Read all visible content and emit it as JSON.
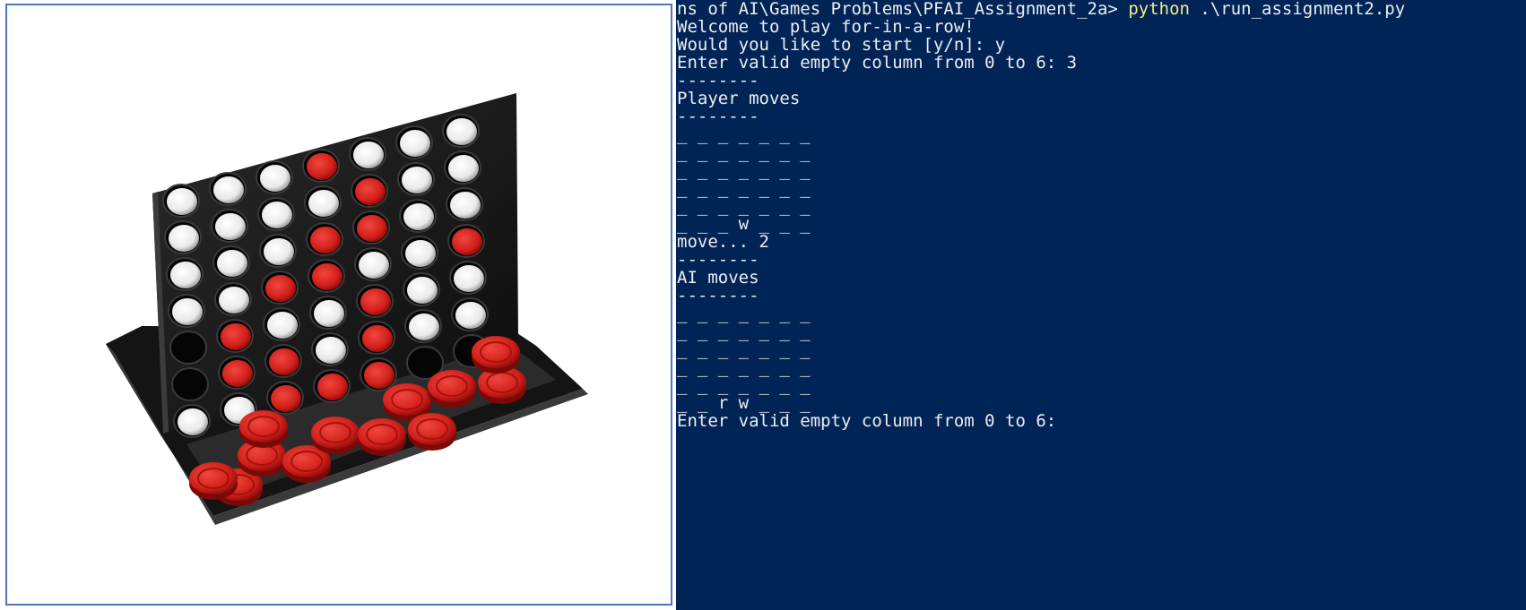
{
  "colors": {
    "terminal_bg": "#012456",
    "terminal_fg": "#eeedf0",
    "command": "#f4e98c",
    "panel_border": "#4f74b8"
  },
  "image_panel": {
    "icon": "connect-four-board-photo"
  },
  "board_photo": {
    "white_discs_in_grid": [
      [
        0,
        0
      ],
      [
        1,
        0
      ],
      [
        2,
        0
      ],
      [
        4,
        0
      ],
      [
        5,
        0
      ],
      [
        6,
        0
      ],
      [
        0,
        1
      ],
      [
        1,
        1
      ],
      [
        2,
        1
      ],
      [
        3,
        1
      ],
      [
        5,
        1
      ],
      [
        6,
        1
      ],
      [
        0,
        2
      ],
      [
        1,
        2
      ],
      [
        2,
        2
      ],
      [
        5,
        2
      ],
      [
        6,
        2
      ],
      [
        0,
        3
      ],
      [
        1,
        3
      ],
      [
        3,
        3
      ],
      [
        4,
        3
      ],
      [
        5,
        3
      ],
      [
        2,
        4
      ],
      [
        3,
        4
      ],
      [
        5,
        4
      ],
      [
        6,
        4
      ],
      [
        1,
        5
      ],
      [
        2,
        5
      ],
      [
        3,
        5
      ],
      [
        5,
        5
      ],
      [
        6,
        5
      ],
      [
        0,
        6
      ],
      [
        1,
        6
      ]
    ],
    "red_discs_in_grid": [
      [
        3,
        0
      ],
      [
        4,
        1
      ],
      [
        3,
        2
      ],
      [
        4,
        2
      ],
      [
        2,
        3
      ],
      [
        3,
        3
      ],
      [
        6,
        3
      ],
      [
        1,
        4
      ],
      [
        4,
        4
      ],
      [
        1,
        5
      ],
      [
        2,
        5
      ],
      [
        4,
        5
      ],
      [
        2,
        6
      ],
      [
        3,
        6
      ],
      [
        4,
        6
      ]
    ],
    "loose_red_discs": 12
  },
  "terminal": {
    "prompt": "ns of AI\\Games Problems\\PFAI_Assignment_2a> ",
    "command": "python",
    "args": " .\\run_assignment2.py",
    "lines": [
      "Welcome to play for-in-a-row!",
      "Would you like to start [y/n]: y",
      "Enter valid empty column from 0 to 6: 3",
      "--------",
      "Player moves",
      "--------",
      "_ _ _ _ _ _ _",
      "_ _ _ _ _ _ _",
      "_ _ _ _ _ _ _",
      "_ _ _ _ _ _ _",
      "_ _ _ _ _ _ _",
      "_ _ _ w _ _ _",
      "move... 2",
      "--------",
      "AI moves",
      "--------",
      "_ _ _ _ _ _ _",
      "_ _ _ _ _ _ _",
      "_ _ _ _ _ _ _",
      "_ _ _ _ _ _ _",
      "_ _ _ _ _ _ _",
      "_ _ r w _ _ _",
      "Enter valid empty column from 0 to 6:"
    ]
  }
}
